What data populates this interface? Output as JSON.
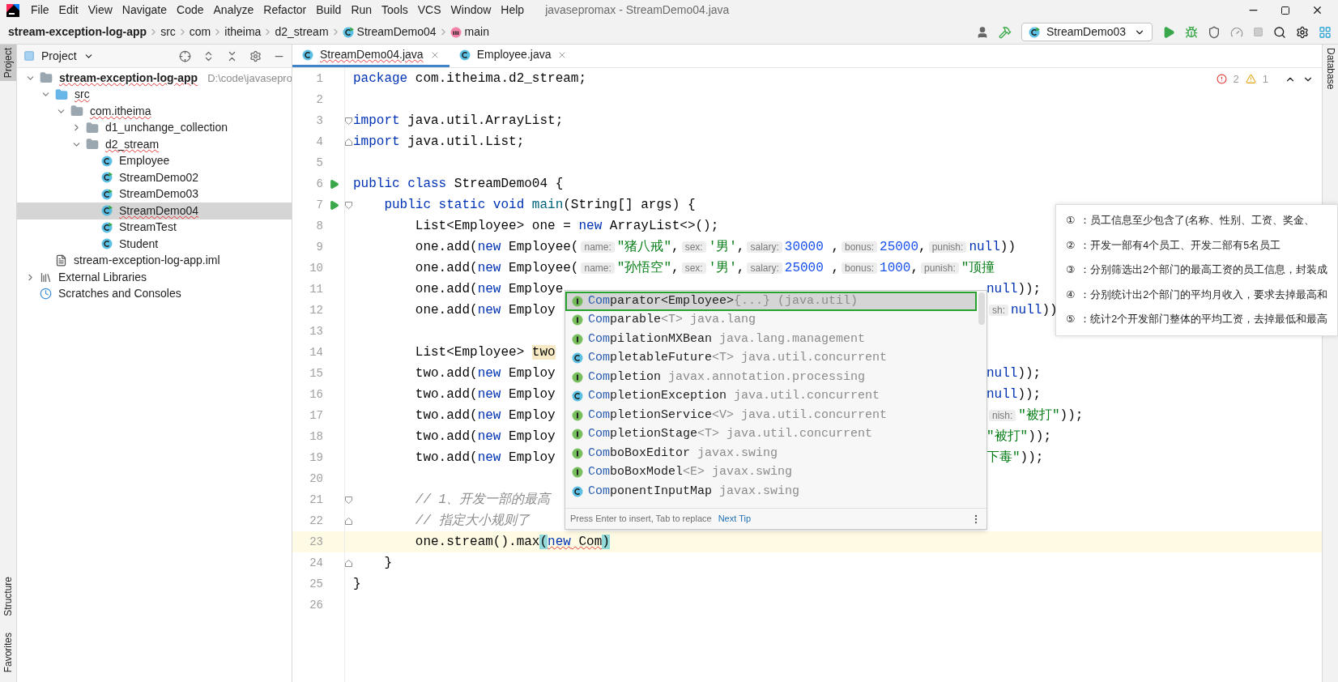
{
  "menu": [
    "File",
    "Edit",
    "View",
    "Navigate",
    "Code",
    "Analyze",
    "Refactor",
    "Build",
    "Run",
    "Tools",
    "VCS",
    "Window",
    "Help"
  ],
  "window": {
    "title": "javasepromax - StreamDemo04.java"
  },
  "breadcrumb": [
    {
      "label": "stream-exception-log-app",
      "kind": "module"
    },
    {
      "label": "src",
      "kind": "folder"
    },
    {
      "label": "com",
      "kind": "folder"
    },
    {
      "label": "itheima",
      "kind": "folder"
    },
    {
      "label": "d2_stream",
      "kind": "folder"
    },
    {
      "label": "StreamDemo04",
      "kind": "class"
    },
    {
      "label": "main",
      "kind": "method"
    }
  ],
  "run_config": "StreamDemo03",
  "left_strip": [
    {
      "label": "Project",
      "selected": true
    },
    {
      "label": "Structure",
      "selected": false
    },
    {
      "label": "Favorites",
      "selected": false
    }
  ],
  "right_strip": [
    "Database"
  ],
  "project_panel": {
    "title": "Project",
    "tree": [
      {
        "label": "stream-exception-log-app",
        "kind": "module",
        "path": "D:\\code\\javasepro",
        "expanded": true,
        "selected": false,
        "error": true,
        "children": [
          {
            "label": "src",
            "kind": "source",
            "expanded": true,
            "selected": false,
            "error": true,
            "children": [
              {
                "label": "com.itheima",
                "kind": "package",
                "expanded": true,
                "selected": false,
                "error": true,
                "children": [
                  {
                    "label": "d1_unchange_collection",
                    "kind": "package",
                    "expanded": false,
                    "selected": false,
                    "error": false
                  },
                  {
                    "label": "d2_stream",
                    "kind": "package",
                    "expanded": true,
                    "selected": false,
                    "error": true,
                    "children": [
                      {
                        "label": "Employee",
                        "kind": "class",
                        "selected": false,
                        "error": false
                      },
                      {
                        "label": "StreamDemo02",
                        "kind": "runnable",
                        "selected": false,
                        "error": false
                      },
                      {
                        "label": "StreamDemo03",
                        "kind": "runnable",
                        "selected": false,
                        "error": false
                      },
                      {
                        "label": "StreamDemo04",
                        "kind": "runnable",
                        "selected": true,
                        "error": true
                      },
                      {
                        "label": "StreamTest",
                        "kind": "runnable",
                        "selected": false,
                        "error": false
                      },
                      {
                        "label": "Student",
                        "kind": "class",
                        "selected": false,
                        "error": false
                      }
                    ]
                  }
                ]
              }
            ]
          },
          {
            "label": "stream-exception-log-app.iml",
            "kind": "file",
            "selected": false,
            "error": false
          }
        ]
      },
      {
        "label": "External Libraries",
        "kind": "libraries",
        "expanded": false,
        "selected": false,
        "error": false
      },
      {
        "label": "Scratches and Consoles",
        "kind": "scratches",
        "selected": false,
        "error": false
      }
    ]
  },
  "tabs": [
    {
      "label": "StreamDemo04.java",
      "selected": true,
      "error": true
    },
    {
      "label": "Employee.java",
      "selected": false,
      "error": false
    }
  ],
  "inspections": {
    "errors": "2",
    "warnings": "1"
  },
  "code": [
    {
      "number": "1",
      "current": false,
      "run": false,
      "fold_start": false,
      "fold_end": false,
      "left": [
        {
          "kind": "keyword",
          "text": "package"
        },
        {
          "kind": "plain",
          "text": " com.itheima.d2_stream;"
        }
      ]
    },
    {
      "number": "2",
      "current": false,
      "run": false,
      "fold_start": false,
      "fold_end": false
    },
    {
      "number": "3",
      "current": false,
      "run": false,
      "fold_start": true,
      "fold_end": false,
      "left": [
        {
          "kind": "keyword",
          "text": "import"
        },
        {
          "kind": "plain",
          "text": " java.util.ArrayList;"
        }
      ]
    },
    {
      "number": "4",
      "current": false,
      "run": false,
      "fold_start": false,
      "fold_end": true,
      "left": [
        {
          "kind": "keyword",
          "text": "import"
        },
        {
          "kind": "plain",
          "text": " java.util.List;"
        }
      ]
    },
    {
      "number": "5",
      "current": false,
      "run": false,
      "fold_start": false,
      "fold_end": false
    },
    {
      "number": "6",
      "current": false,
      "run": true,
      "fold_start": false,
      "fold_end": false,
      "left": [
        {
          "kind": "keyword",
          "text": "public class"
        },
        {
          "kind": "plain",
          "text": " StreamDemo04 {"
        }
      ]
    },
    {
      "number": "7",
      "current": false,
      "run": true,
      "fold_start": true,
      "fold_end": false,
      "left": [
        {
          "kind": "keyword",
          "text": "    public static void"
        },
        {
          "kind": "method",
          "text": " main"
        },
        {
          "kind": "plain",
          "text": "(String[] args) {"
        }
      ]
    },
    {
      "number": "8",
      "current": false,
      "run": false,
      "fold_start": false,
      "fold_end": false,
      "left": [
        {
          "kind": "plain",
          "text": "        List<Employee> one = "
        },
        {
          "kind": "keyword",
          "text": "new"
        },
        {
          "kind": "plain",
          "text": " ArrayList<>();"
        }
      ]
    },
    {
      "number": "9",
      "current": false,
      "run": false,
      "fold_start": false,
      "fold_end": false,
      "left": [
        {
          "kind": "plain",
          "text": "        one.add("
        },
        {
          "kind": "keyword",
          "text": "new"
        },
        {
          "kind": "plain",
          "text": " Employee("
        },
        {
          "kind": "hint",
          "text": "name:"
        },
        {
          "kind": "string",
          "text": "\"猪八戒\""
        },
        {
          "kind": "plain",
          "text": ","
        },
        {
          "kind": "hint",
          "text": "sex:"
        },
        {
          "kind": "string",
          "text": "'男'"
        },
        {
          "kind": "plain",
          "text": ","
        },
        {
          "kind": "hint",
          "text": "salary:"
        },
        {
          "kind": "number",
          "text": "30000"
        },
        {
          "kind": "plain",
          "text": " ,"
        },
        {
          "kind": "hint",
          "text": "bonus:"
        },
        {
          "kind": "number",
          "text": "25000"
        },
        {
          "kind": "plain",
          "text": ","
        },
        {
          "kind": "hint",
          "text": "punish:"
        },
        {
          "kind": "keyword",
          "text": "null"
        },
        {
          "kind": "plain",
          "text": "))"
        }
      ]
    },
    {
      "number": "10",
      "current": false,
      "run": false,
      "fold_start": false,
      "fold_end": false,
      "left": [
        {
          "kind": "plain",
          "text": "        one.add("
        },
        {
          "kind": "keyword",
          "text": "new"
        },
        {
          "kind": "plain",
          "text": " Employee("
        },
        {
          "kind": "hint",
          "text": "name:"
        },
        {
          "kind": "string",
          "text": "\"孙悟空\""
        },
        {
          "kind": "plain",
          "text": ","
        },
        {
          "kind": "hint",
          "text": "sex:"
        },
        {
          "kind": "string",
          "text": "'男'"
        },
        {
          "kind": "plain",
          "text": ","
        },
        {
          "kind": "hint",
          "text": "salary:"
        },
        {
          "kind": "number",
          "text": "25000"
        },
        {
          "kind": "plain",
          "text": " ,"
        },
        {
          "kind": "hint",
          "text": "bonus:"
        },
        {
          "kind": "number",
          "text": "1000"
        },
        {
          "kind": "plain",
          "text": ","
        },
        {
          "kind": "hint",
          "text": "punish:"
        },
        {
          "kind": "string",
          "text": "\"顶撞"
        }
      ]
    },
    {
      "number": "11",
      "current": false,
      "run": false,
      "fold_start": false,
      "fold_end": false,
      "left": [
        {
          "kind": "plain",
          "text": "        one.add("
        },
        {
          "kind": "keyword",
          "text": "new"
        },
        {
          "kind": "plain",
          "text": " Employe"
        }
      ],
      "right": [
        {
          "kind": "keyword",
          "text": "null"
        },
        {
          "kind": "plain",
          "text": "));"
        }
      ]
    },
    {
      "number": "12",
      "current": false,
      "run": false,
      "fold_start": false,
      "fold_end": false,
      "left": [
        {
          "kind": "plain",
          "text": "        one.add("
        },
        {
          "kind": "keyword",
          "text": "new"
        },
        {
          "kind": "plain",
          "text": " Employ"
        }
      ],
      "right": [
        {
          "kind": "hint",
          "text": "sh:"
        },
        {
          "kind": "keyword",
          "text": "null"
        },
        {
          "kind": "plain",
          "text": "))"
        }
      ]
    },
    {
      "number": "13",
      "current": false,
      "run": false,
      "fold_start": false,
      "fold_end": false
    },
    {
      "number": "14",
      "current": false,
      "run": false,
      "fold_start": false,
      "fold_end": false,
      "left": [
        {
          "kind": "plain",
          "text": "        List<Employee> "
        },
        {
          "kind": "highlight",
          "text": "two"
        }
      ]
    },
    {
      "number": "15",
      "current": false,
      "run": false,
      "fold_start": false,
      "fold_end": false,
      "left": [
        {
          "kind": "plain",
          "text": "        two.add("
        },
        {
          "kind": "keyword",
          "text": "new"
        },
        {
          "kind": "plain",
          "text": " Employ"
        }
      ],
      "right": [
        {
          "kind": "keyword",
          "text": "null"
        },
        {
          "kind": "plain",
          "text": "));"
        }
      ]
    },
    {
      "number": "16",
      "current": false,
      "run": false,
      "fold_start": false,
      "fold_end": false,
      "left": [
        {
          "kind": "plain",
          "text": "        two.add("
        },
        {
          "kind": "keyword",
          "text": "new"
        },
        {
          "kind": "plain",
          "text": " Employ"
        }
      ],
      "right": [
        {
          "kind": "keyword",
          "text": "null"
        },
        {
          "kind": "plain",
          "text": "));"
        }
      ]
    },
    {
      "number": "17",
      "current": false,
      "run": false,
      "fold_start": false,
      "fold_end": false,
      "left": [
        {
          "kind": "plain",
          "text": "        two.add("
        },
        {
          "kind": "keyword",
          "text": "new"
        },
        {
          "kind": "plain",
          "text": " Employ"
        }
      ],
      "right": [
        {
          "kind": "hint",
          "text": "nish:"
        },
        {
          "kind": "string",
          "text": "\"被打\""
        },
        {
          "kind": "plain",
          "text": "));"
        }
      ]
    },
    {
      "number": "18",
      "current": false,
      "run": false,
      "fold_start": false,
      "fold_end": false,
      "left": [
        {
          "kind": "plain",
          "text": "        two.add("
        },
        {
          "kind": "keyword",
          "text": "new"
        },
        {
          "kind": "plain",
          "text": " Employ"
        }
      ],
      "right": [
        {
          "kind": "string",
          "text": "\"被打\""
        },
        {
          "kind": "plain",
          "text": "));"
        }
      ]
    },
    {
      "number": "19",
      "current": false,
      "run": false,
      "fold_start": false,
      "fold_end": false,
      "left": [
        {
          "kind": "plain",
          "text": "        two.add("
        },
        {
          "kind": "keyword",
          "text": "new"
        },
        {
          "kind": "plain",
          "text": " Employ"
        }
      ],
      "right": [
        {
          "kind": "string",
          "text": "下毒\""
        },
        {
          "kind": "plain",
          "text": "));"
        }
      ]
    },
    {
      "number": "20",
      "current": false,
      "run": false,
      "fold_start": false,
      "fold_end": false
    },
    {
      "number": "21",
      "current": false,
      "run": false,
      "fold_start": true,
      "fold_end": false,
      "left": [
        {
          "kind": "comment",
          "text": "        // 1、开发一部的最高"
        }
      ]
    },
    {
      "number": "22",
      "current": false,
      "run": false,
      "fold_start": false,
      "fold_end": true,
      "left": [
        {
          "kind": "comment",
          "text": "        // 指定大小规则了"
        }
      ]
    },
    {
      "number": "23",
      "current": true,
      "run": false,
      "fold_start": false,
      "fold_end": false,
      "left": [
        {
          "kind": "plain",
          "text": "        one.stream().max"
        },
        {
          "kind": "brace",
          "text": "("
        },
        {
          "kind": "error_keyword",
          "text": "new"
        },
        {
          "kind": "error",
          "text": " Com"
        },
        {
          "kind": "brace",
          "text": ")"
        }
      ]
    },
    {
      "number": "24",
      "current": false,
      "run": false,
      "fold_start": false,
      "fold_end": true,
      "left": [
        {
          "kind": "plain",
          "text": "    }"
        }
      ]
    },
    {
      "number": "25",
      "current": false,
      "run": false,
      "fold_start": false,
      "fold_end": false,
      "left": [
        {
          "kind": "plain",
          "text": "}"
        }
      ]
    },
    {
      "number": "26",
      "current": false,
      "run": false,
      "fold_start": false,
      "fold_end": false
    }
  ],
  "completion": {
    "items": [
      {
        "kind": "interface",
        "match": "Com",
        "name": "parator<Employee>",
        "suffix": "{...}",
        "package": "(java.util)",
        "selected": true
      },
      {
        "kind": "interface",
        "match": "Com",
        "name": "parable",
        "suffix": "<T>",
        "package": "java.lang",
        "selected": false
      },
      {
        "kind": "interface",
        "match": "Com",
        "name": "pilationMXBean",
        "package": "java.lang.management",
        "selected": false
      },
      {
        "kind": "class",
        "match": "Com",
        "name": "pletableFuture",
        "suffix": "<T>",
        "package": "java.util.concurrent",
        "selected": false
      },
      {
        "kind": "interface",
        "match": "Com",
        "name": "pletion",
        "package": "javax.annotation.processing",
        "selected": false
      },
      {
        "kind": "class",
        "match": "Com",
        "name": "pletionException",
        "package": "java.util.concurrent",
        "selected": false
      },
      {
        "kind": "interface",
        "match": "Com",
        "name": "pletionService",
        "suffix": "<V>",
        "package": "java.util.concurrent",
        "selected": false
      },
      {
        "kind": "interface",
        "match": "Com",
        "name": "pletionStage",
        "suffix": "<T>",
        "package": "java.util.concurrent",
        "selected": false
      },
      {
        "kind": "interface",
        "match": "Com",
        "name": "boBoxEditor",
        "package": "javax.swing",
        "selected": false
      },
      {
        "kind": "interface",
        "match": "Com",
        "name": "boBoxModel",
        "suffix": "<E>",
        "package": "javax.swing",
        "selected": false
      },
      {
        "kind": "class",
        "match": "Com",
        "name": "ponentInputMap",
        "package": "javax.swing",
        "selected": false
      }
    ],
    "hint": "Press Enter to insert, Tab to replace",
    "link": "Next Tip"
  },
  "notes": [
    {
      "mark": "①",
      "text": "：员工信息至少包含了(名称、性别、工资、奖金、"
    },
    {
      "mark": "②",
      "text": "：开发一部有4个员工、开发二部有5名员工"
    },
    {
      "mark": "③",
      "text": "：分别筛选出2个部门的最高工资的员工信息，封装成"
    },
    {
      "mark": "④",
      "text": "：分别统计出2个部门的平均月收入，要求去掉最高和"
    },
    {
      "mark": "⑤",
      "text": "：统计2个开发部门整体的平均工资，去掉最低和最高"
    }
  ]
}
